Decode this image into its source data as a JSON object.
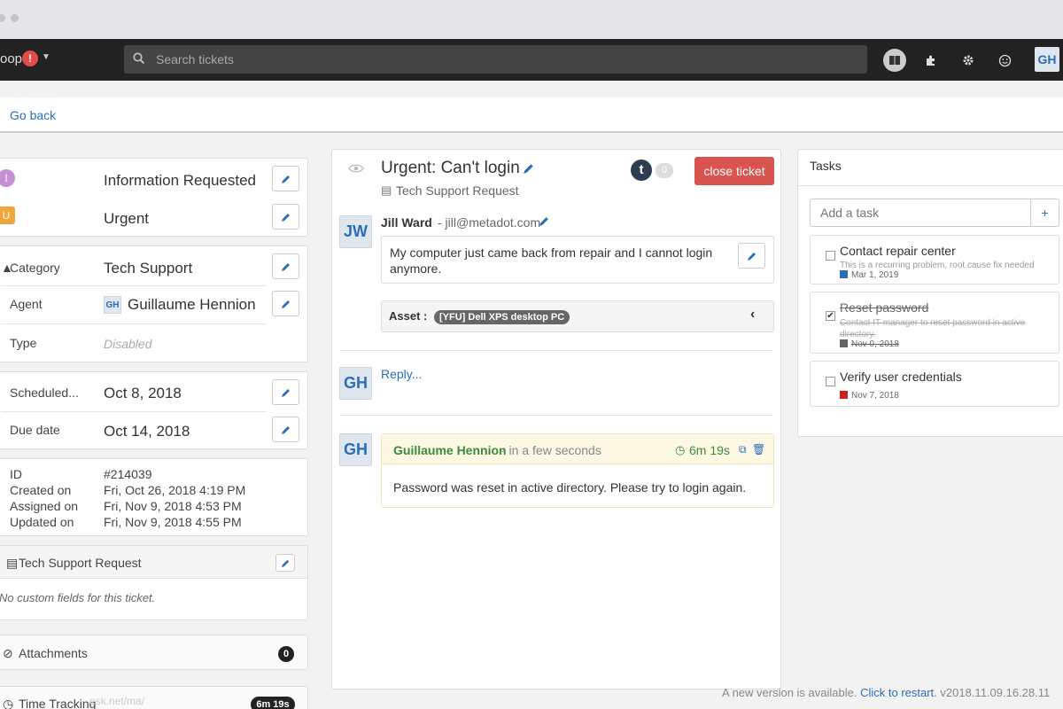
{
  "nav": {
    "brand": "oop",
    "brand_alert": "!",
    "search_placeholder": "Search tickets",
    "user_initials": "GH"
  },
  "backbar": {
    "go_back": "Go back"
  },
  "left": {
    "status": {
      "badge": "I",
      "label": "Information Requested",
      "color": "#c98fd6"
    },
    "priority": {
      "badge": "U",
      "label": "Urgent",
      "color": "#f0a53c"
    },
    "category": {
      "label": "Category",
      "value": "Tech Support"
    },
    "agent": {
      "label": "Agent",
      "initials": "GH",
      "value": "Guillaume Hennion"
    },
    "type": {
      "label": "Type",
      "value": "Disabled"
    },
    "scheduled": {
      "label": "Scheduled...",
      "value": "Oct 8, 2018"
    },
    "due": {
      "label": "Due date",
      "value": "Oct 14, 2018"
    },
    "meta": [
      {
        "label": "ID",
        "value": "#214039"
      },
      {
        "label": "Created on",
        "value": "Fri, Oct 26, 2018 4:19 PM"
      },
      {
        "label": "Assigned on",
        "value": "Fri, Nov 9, 2018 4:53 PM"
      },
      {
        "label": "Updated on",
        "value": "Fri, Nov 9, 2018 4:55 PM"
      }
    ],
    "form": {
      "title": "Tech Support Request",
      "empty": "No custom fields for this ticket."
    },
    "attachments": {
      "label": "Attachments",
      "count": "0"
    },
    "time_tracking": {
      "label": "Time Tracking",
      "value": "6m 19s",
      "url_hint": "esk.net/ma/"
    }
  },
  "ticket": {
    "title": "Urgent: Can't login",
    "form_name": "Tech Support Request",
    "counter": "0",
    "close_label": "close ticket",
    "requester": {
      "initials": "JW",
      "name": "Jill Ward",
      "email": " - jill@metadot.com",
      "message": "My computer just came back from repair and I cannot login anymore."
    },
    "asset": {
      "label": "Asset :",
      "value": "[YFU] Dell XPS desktop PC"
    },
    "reply": {
      "initials": "GH",
      "label": "Reply..."
    },
    "note": {
      "initials": "GH",
      "author": "Guillaume Hennion",
      "when": " - in a few seconds",
      "duration": "6m 19s",
      "text": "Password was reset in active directory. Please try to login again."
    }
  },
  "tasks": {
    "title": "Tasks",
    "add_placeholder": "Add a task",
    "add_button": "+",
    "items": [
      {
        "title": "Contact repair center",
        "desc": "This is a recurring problem, root cause fix needed",
        "date": "Mar 1, 2019",
        "done": false,
        "color": "#2a6ebb"
      },
      {
        "title": "Reset password",
        "desc": "Contact IT manager to reset password in active directory.",
        "date": "Nov 0, 2018",
        "done": true,
        "color": "#666666"
      },
      {
        "title": "Verify user credentials",
        "desc": "",
        "date": "Nov 7, 2018",
        "done": false,
        "color": "#cc2222"
      }
    ]
  },
  "footer": {
    "notice": "A new version is available. ",
    "restart": "Click to restart",
    "version": ". v2018.11.09.16.28.11"
  },
  "colors": {
    "accent": "#2a6ebb",
    "danger": "#d9534f",
    "note_green": "#3c8a3c"
  }
}
